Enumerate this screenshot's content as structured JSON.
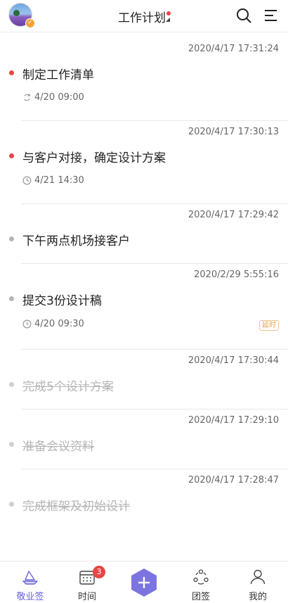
{
  "header": {
    "title": "工作计划",
    "badge_check": "✓"
  },
  "tasks": [
    {
      "timestamp": "2020/4/17 17:31:24",
      "title": "制定工作清单",
      "status": "active",
      "meta_icon": "repeat-icon",
      "meta_time": "4/20 09:00",
      "tag": ""
    },
    {
      "timestamp": "2020/4/17 17:30:13",
      "title": "与客户对接，确定设计方案",
      "status": "active",
      "meta_icon": "clock-icon",
      "meta_time": "4/21 14:30",
      "tag": ""
    },
    {
      "timestamp": "2020/4/17 17:29:42",
      "title": "下午两点机场接客户",
      "status": "pending",
      "meta_icon": "",
      "meta_time": "",
      "tag": ""
    },
    {
      "timestamp": "2020/2/29 5:55:16",
      "title": "提交3份设计稿",
      "status": "pending",
      "meta_icon": "clock-icon",
      "meta_time": "4/20 09:30",
      "tag": "延时"
    },
    {
      "timestamp": "2020/4/17 17:30:44",
      "title": "完成5个设计方案",
      "status": "done",
      "meta_icon": "",
      "meta_time": "",
      "tag": ""
    },
    {
      "timestamp": "2020/4/17 17:29:10",
      "title": "准备会议资料",
      "status": "done",
      "meta_icon": "",
      "meta_time": "",
      "tag": ""
    },
    {
      "timestamp": "2020/4/17 17:28:47",
      "title": "完成框架及初始设计",
      "status": "done",
      "meta_icon": "",
      "meta_time": "",
      "tag": ""
    }
  ],
  "tabbar": {
    "tabs": [
      {
        "label": "敬业签",
        "icon": "boat-icon",
        "active": true
      },
      {
        "label": "时间",
        "icon": "calendar-icon",
        "badge": "3"
      },
      {
        "label": "",
        "icon": "add-icon"
      },
      {
        "label": "团签",
        "icon": "group-icon"
      },
      {
        "label": "我的",
        "icon": "user-icon"
      }
    ]
  },
  "colors": {
    "accent": "#6a64d8",
    "dot_active": "#e84545",
    "dot_pending": "#b5b5b5",
    "tag": "#e8a04a"
  }
}
